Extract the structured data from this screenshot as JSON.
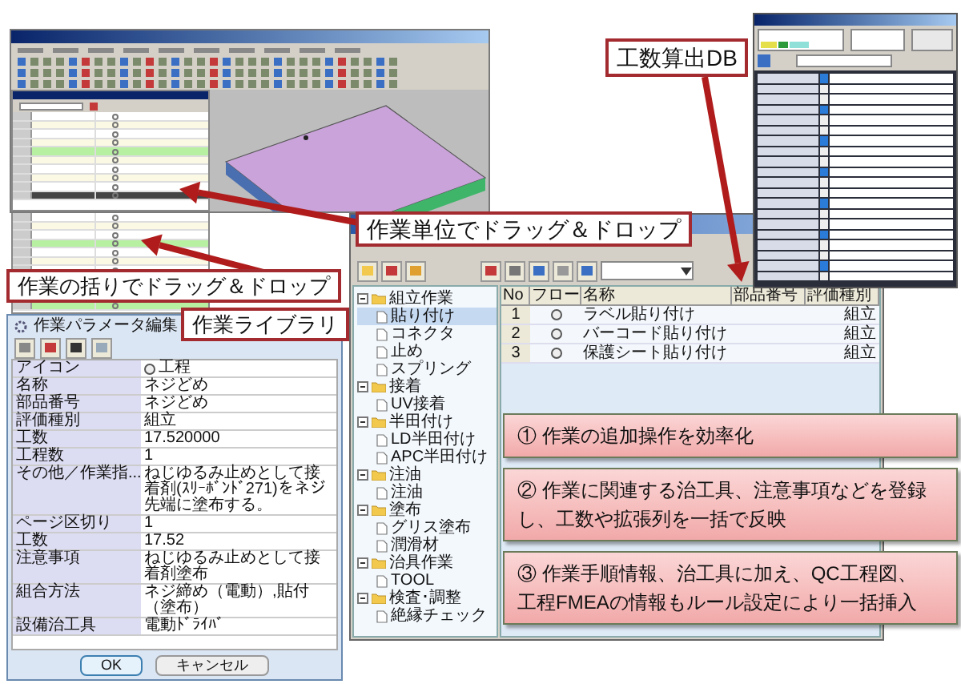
{
  "db_label": {
    "text": "工数算出DB"
  },
  "drag_unit_label": {
    "text": "作業単位でドラッグ＆ドロップ"
  },
  "drag_group_label": {
    "text": "作業の括りでドラッグ＆ドロップ"
  },
  "library_label": {
    "text": "作業ライブラリ"
  },
  "task_window": {
    "tree": [
      {
        "label": "組立作業",
        "expanded": true,
        "selected": false,
        "children": [
          {
            "label": "貼り付け",
            "selected": true
          },
          {
            "label": "コネクタ",
            "selected": false
          },
          {
            "label": "止め",
            "selected": false
          },
          {
            "label": "スプリング",
            "selected": false
          }
        ]
      },
      {
        "label": "接着",
        "expanded": true,
        "selected": false,
        "children": [
          {
            "label": "UV接着",
            "selected": false
          }
        ]
      },
      {
        "label": "半田付け",
        "expanded": true,
        "selected": false,
        "children": [
          {
            "label": "LD半田付け",
            "selected": false
          },
          {
            "label": "APC半田付け",
            "selected": false
          }
        ]
      },
      {
        "label": "注油",
        "expanded": true,
        "selected": false,
        "children": [
          {
            "label": "注油",
            "selected": false
          }
        ]
      },
      {
        "label": "塗布",
        "expanded": true,
        "selected": false,
        "children": [
          {
            "label": "グリス塗布",
            "selected": false
          },
          {
            "label": "潤滑材",
            "selected": false
          }
        ]
      },
      {
        "label": "治具作業",
        "expanded": true,
        "selected": false,
        "children": [
          {
            "label": "TOOL",
            "selected": false
          }
        ]
      },
      {
        "label": "検査･調整",
        "expanded": true,
        "selected": false,
        "children": [
          {
            "label": "絶縁チェック",
            "selected": false
          }
        ]
      }
    ],
    "table": {
      "columns": [
        "No",
        "フロー",
        "名称",
        "部品番号",
        "評価種別"
      ],
      "rows": [
        {
          "no": "1",
          "name": "ラベル貼り付け",
          "eval_type": "組立"
        },
        {
          "no": "2",
          "name": "バーコード貼り付け",
          "eval_type": "組立"
        },
        {
          "no": "3",
          "name": "保護シート貼り付け",
          "eval_type": "組立"
        }
      ]
    }
  },
  "parameter_dialog": {
    "title": "作業パラメータ編集",
    "rows": [
      {
        "kind": "icon",
        "label": "アイコン",
        "value": "工程"
      },
      {
        "kind": "text",
        "label": "名称",
        "value": "ネジどめ"
      },
      {
        "kind": "text",
        "label": "部品番号",
        "value": "ネジどめ"
      },
      {
        "kind": "text",
        "label": "評価種別",
        "value": "組立"
      },
      {
        "kind": "text",
        "label": "工数",
        "value": "17.520000"
      },
      {
        "kind": "text",
        "label": "工程数",
        "value": "1"
      },
      {
        "kind": "text",
        "label": "その他／作業指...",
        "value": "ねじゆるみ止めとして接着剤(ｽﾘｰﾎﾞﾝﾄﾞ271)をネジ先端に塗布する。"
      },
      {
        "kind": "text",
        "label": "ページ区切り",
        "value": "1"
      },
      {
        "kind": "text",
        "label": "工数",
        "value": "17.52"
      },
      {
        "kind": "text",
        "label": "注意事項",
        "value": "ねじゆるみ止めとして接着剤塗布"
      },
      {
        "kind": "text",
        "label": "組合方法",
        "value": "ネジ締め（電動）,貼付（塗布）"
      },
      {
        "kind": "text",
        "label": "設備治工具",
        "value": "電動ﾄﾞﾗｲﾊﾞ"
      }
    ],
    "buttons": [
      {
        "kind": "ok",
        "label": "OK"
      },
      {
        "kind": "cancel",
        "label": "キャンセル"
      }
    ]
  },
  "notes": [
    {
      "lines": [
        "① 作業の追加操作を効率化"
      ]
    },
    {
      "lines": [
        "② 作業に関連する治工具、注意事項などを登録",
        "し、工数や拡張列を一括で反映"
      ]
    },
    {
      "lines": [
        "③ 作業手順情報、治工具に加え、QC工程図、",
        "工程FMEAの情報もルール設定により一括挿入"
      ]
    }
  ]
}
